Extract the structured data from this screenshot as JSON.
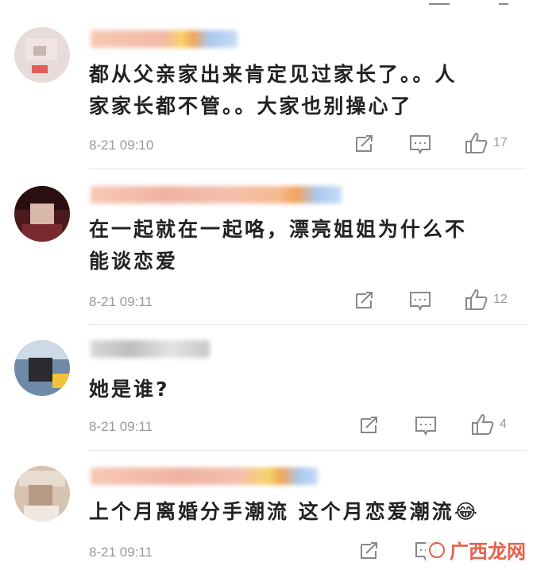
{
  "comments": [
    {
      "text_line1": "都从父亲家出来肯定见过家长了。。人",
      "text_line2": "家家长都不管。。大家也别操心了",
      "time": "8-21 09:10",
      "likes": "17"
    },
    {
      "text_line1": "在一起就在一起咯，漂亮姐姐为什么不",
      "text_line2": "能谈恋爱",
      "time": "8-21 09:11",
      "likes": "12"
    },
    {
      "text_line1": "她是谁?",
      "text_line2": "",
      "time": "8-21 09:11",
      "likes": "4"
    },
    {
      "text_line1": "上个月离婚分手潮流 这个月恋爱潮流😂",
      "text_line2": "",
      "time": "8-21 09:11",
      "likes": ""
    }
  ],
  "icons": {
    "share": "share-icon",
    "reply": "comment-icon",
    "like": "thumbs-up-icon"
  },
  "colors": {
    "meta": "#999999",
    "divider": "#e6e6e6",
    "watermark": "#e8604a"
  },
  "watermark": {
    "text": "广西龙网"
  }
}
